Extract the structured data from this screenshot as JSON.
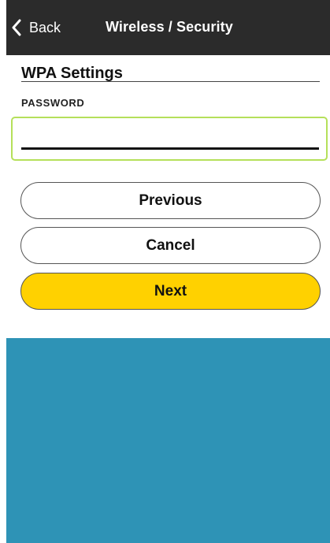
{
  "nav": {
    "back_label": "Back",
    "title": "Wireless / Security"
  },
  "section": {
    "title": "WPA Settings"
  },
  "password": {
    "label": "PASSWORD",
    "value": "",
    "placeholder": ""
  },
  "buttons": {
    "previous": "Previous",
    "cancel": "Cancel",
    "next": "Next"
  },
  "colors": {
    "nav_background": "#2b2b2b",
    "accent_yellow": "#ffd100",
    "focus_green": "#b5e05a",
    "footer_blue": "#2e93b6"
  },
  "icons": {
    "back": "chevron-left-icon"
  }
}
